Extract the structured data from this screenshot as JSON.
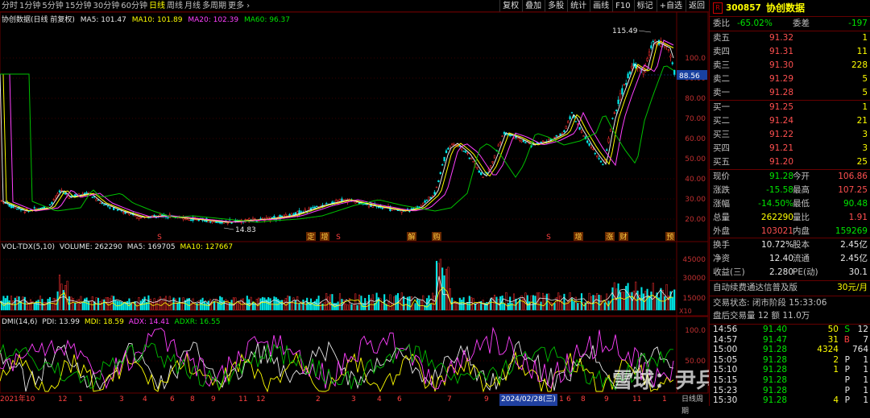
{
  "toolbar": {
    "periods": [
      "分时",
      "1分钟",
      "5分钟",
      "15分钟",
      "30分钟",
      "60分钟",
      "日线",
      "周线",
      "月线",
      "多周期",
      "更多 ›"
    ],
    "active_period": "日线",
    "right_buttons": [
      "复权",
      "叠加",
      "多股",
      "统计",
      "画线",
      "F10",
      "标记",
      "+自选",
      "返回"
    ]
  },
  "main": {
    "legend": {
      "name": "协创数据(日线 前复权)",
      "ma5": "MA5: 101.47",
      "ma10": "MA10: 101.89",
      "ma20": "MA20: 102.39",
      "ma60": "MA60: 96.37"
    },
    "y_ticks": [
      "100.0",
      "90.00",
      "80.00",
      "70.00",
      "60.00",
      "50.00",
      "40.00",
      "30.00",
      "20.00"
    ],
    "high_label": "115.49",
    "low_label": "14.83",
    "current_price_tag": "88.56",
    "event_marks": [
      "S",
      "定",
      "增",
      "S",
      "解",
      "购",
      "S",
      "增",
      "涨",
      "财",
      "预"
    ]
  },
  "volume": {
    "header": {
      "name": "VOL-TDX(5,10)",
      "volume": "VOLUME: 262290",
      "ma5": "MA5: 169705",
      "ma10": "MA10: 127667"
    },
    "y_ticks": [
      "45000",
      "30000",
      "15000"
    ],
    "unit": "X10"
  },
  "dmi": {
    "header": {
      "name": "DMI(14,6)",
      "pdi": "PDI: 13.99",
      "mdi": "MDI: 18.59",
      "adx": "ADX: 14.41",
      "adxr": "ADXR: 16.55"
    },
    "y_ticks": [
      "100.0",
      "50.00"
    ]
  },
  "bottom_axis": {
    "labels": [
      "2021年10",
      "12",
      "1",
      "3",
      "4",
      "6",
      "8",
      "9",
      "11",
      "12",
      "2",
      "3",
      "4",
      "6",
      "7",
      "9",
      "10",
      "12",
      "1",
      "2024/02/28(三)",
      "6",
      "8",
      "9",
      "11",
      "1"
    ],
    "mode": "日线周期"
  },
  "quote": {
    "code": "300857",
    "name": "协创数据",
    "badge": "R",
    "weibi_label": "委比",
    "weibi": "-65.02%",
    "weicha_label": "委差",
    "weicha": "-197",
    "asks": [
      {
        "label": "卖五",
        "price": "91.32",
        "vol": "1"
      },
      {
        "label": "卖四",
        "price": "91.31",
        "vol": "11"
      },
      {
        "label": "卖三",
        "price": "91.30",
        "vol": "228"
      },
      {
        "label": "卖二",
        "price": "91.29",
        "vol": "5"
      },
      {
        "label": "卖一",
        "price": "91.28",
        "vol": "5"
      }
    ],
    "bids": [
      {
        "label": "买一",
        "price": "91.25",
        "vol": "1"
      },
      {
        "label": "买二",
        "price": "91.24",
        "vol": "21"
      },
      {
        "label": "买三",
        "price": "91.22",
        "vol": "3"
      },
      {
        "label": "买四",
        "price": "91.21",
        "vol": "3"
      },
      {
        "label": "买五",
        "price": "91.20",
        "vol": "25"
      }
    ],
    "stats": [
      {
        "k1": "现价",
        "v1": "91.28",
        "k2": "今开",
        "v2": "106.86"
      },
      {
        "k1": "涨跌",
        "v1": "-15.58",
        "k2": "最高",
        "v2": "107.25"
      },
      {
        "k1": "涨幅",
        "v1": "-14.50%",
        "k2": "最低",
        "v2": "90.48"
      },
      {
        "k1": "总量",
        "v1": "262290",
        "k2": "量比",
        "v2": "1.91"
      },
      {
        "k1": "外盘",
        "v1": "103021",
        "k2": "内盘",
        "v2": "159269"
      }
    ],
    "stats2": [
      {
        "k1": "换手",
        "v1": "10.72%",
        "k2": "股本",
        "v2": "2.45亿"
      },
      {
        "k1": "净资",
        "v1": "12.40",
        "k2": "流通",
        "v2": "2.45亿"
      },
      {
        "k1": "收益(三)",
        "v1": "2.280",
        "k2": "PE(动)",
        "v2": "30.1"
      }
    ],
    "promo": "自动续费通达信普及版",
    "promo_price": "30元/月",
    "trade_state": "交易状态: 闭市阶段 15:33:06",
    "after_hours": "盘后交易量 12 额 11.0万",
    "ticks": [
      {
        "t": "14:56",
        "p": "91.40",
        "v": "50",
        "d": "S",
        "n": "12"
      },
      {
        "t": "14:57",
        "p": "91.47",
        "v": "31",
        "d": "B",
        "n": "7"
      },
      {
        "t": "15:00",
        "p": "91.28",
        "v": "4324",
        "d": "",
        "n": "764"
      },
      {
        "t": "15:05",
        "p": "91.28",
        "v": "2",
        "d": "P",
        "n": "1"
      },
      {
        "t": "15:10",
        "p": "91.28",
        "v": "1",
        "d": "P",
        "n": "1"
      },
      {
        "t": "15:15",
        "p": "91.28",
        "v": "",
        "d": "P",
        "n": "1"
      },
      {
        "t": "15:23",
        "p": "91.28",
        "v": "",
        "d": "P",
        "n": "1"
      },
      {
        "t": "15:30",
        "p": "91.28",
        "v": "4",
        "d": "P",
        "n": "1"
      }
    ]
  },
  "watermark": "雪球：尹兵的成长"
}
